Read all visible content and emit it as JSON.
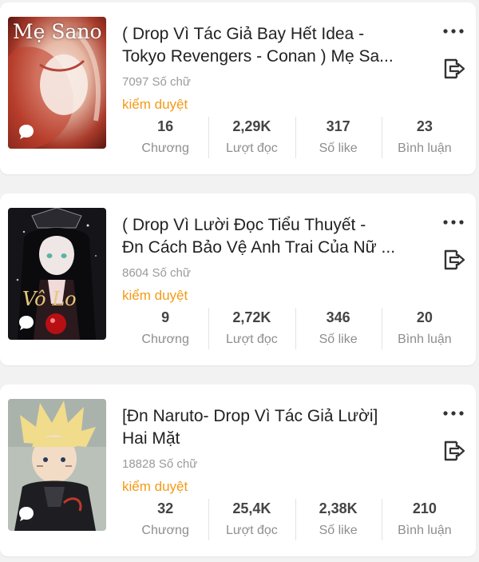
{
  "stories": [
    {
      "title_lines": [
        "( Drop Vì Tác Giả Bay Hết Idea -",
        "Tokyo Revengers - Conan ) Mẹ Sa..."
      ],
      "cover_text": "Mẹ Sano",
      "word_count": "7097 Số chữ",
      "status": "kiểm duyệt",
      "stats": [
        {
          "value": "16",
          "label": "Chương"
        },
        {
          "value": "2,29K",
          "label": "Lượt đọc"
        },
        {
          "value": "317",
          "label": "Số like"
        },
        {
          "value": "23",
          "label": "Bình luận"
        }
      ]
    },
    {
      "title_lines": [
        "( Drop Vì Lười Đọc Tiểu Thuyết -",
        "Đn Cách Bảo Vệ Anh Trai Của Nữ ..."
      ],
      "cover_text": "Vô Lo",
      "word_count": "8604 Số chữ",
      "status": "kiểm duyệt",
      "stats": [
        {
          "value": "9",
          "label": "Chương"
        },
        {
          "value": "2,72K",
          "label": "Lượt đọc"
        },
        {
          "value": "346",
          "label": "Số like"
        },
        {
          "value": "20",
          "label": "Bình luận"
        }
      ]
    },
    {
      "title_lines": [
        "[Đn Naruto- Drop Vì Tác Giả Lười]",
        "Hai Mặt"
      ],
      "cover_text": "",
      "word_count": "18828 Số chữ",
      "status": "kiểm duyệt",
      "stats": [
        {
          "value": "32",
          "label": "Chương"
        },
        {
          "value": "25,4K",
          "label": "Lượt đọc"
        },
        {
          "value": "2,38K",
          "label": "Số like"
        },
        {
          "value": "210",
          "label": "Bình luận"
        }
      ]
    }
  ],
  "icons": {
    "more": "more-horizontal-icon",
    "exit": "exit-icon",
    "comment": "comment-bubble-icon"
  },
  "colors": {
    "status": "#f39a16",
    "background": "#f2f2f2",
    "card": "#ffffff"
  }
}
